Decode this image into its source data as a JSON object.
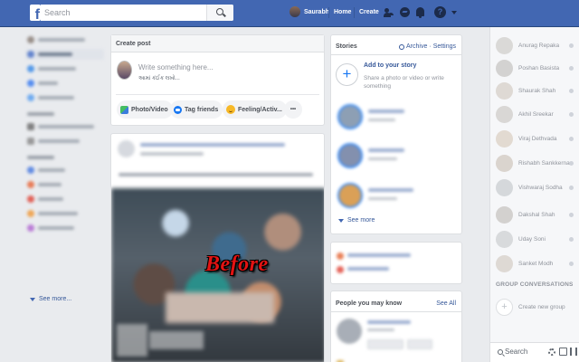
{
  "topbar": {
    "logo": "f",
    "search_placeholder": "Search",
    "user_name": "Saurabh",
    "home_label": "Home",
    "create_label": "Create",
    "help_glyph": "?"
  },
  "left_nav": {
    "see_more_label": "See more..."
  },
  "create_post": {
    "title": "Create post",
    "input_placeholder": "Write something here...",
    "sub_text": "આમાં કંઈક લખો...",
    "photo_video_label": "Photo/Video",
    "tag_friends_label": "Tag friends",
    "feeling_label": "Feeling/Activ...",
    "more_label": "•••"
  },
  "post": {
    "overlay_text": "Before"
  },
  "stories": {
    "title": "Stories",
    "archive_label": "Archive",
    "settings_label": "Settings",
    "separator": "·",
    "add_title": "Add to your story",
    "add_sub": "Share a photo or video or write something",
    "add_glyph": "+",
    "see_more_label": "See more"
  },
  "people": {
    "title": "People you may know",
    "see_all_label": "See All"
  },
  "chat": {
    "contacts": [
      {
        "name": "Anurag Repaka",
        "badge": "",
        "color": "#b9b3ad"
      },
      {
        "name": "Poshan Basista",
        "badge": "",
        "color": "#a8a59f"
      },
      {
        "name": "Shaurak Shah",
        "badge": "",
        "color": "#c2b4a6"
      },
      {
        "name": "Akhil Sreekar",
        "badge": "",
        "color": "#b5b0a9"
      },
      {
        "name": "Viraj Dethvada",
        "badge": "",
        "color": "#c9b6a0"
      },
      {
        "name": "Rishabh Sankkerna",
        "badge": "",
        "color": "#b8a89a"
      },
      {
        "name": "Vishwaraj Sodha",
        "badge": "",
        "color": "#aeb2b5"
      },
      {
        "name": "Dakshal Shah",
        "badge": "",
        "color": "#a9a29b"
      },
      {
        "name": "Uday Soni",
        "badge": "",
        "color": "#b4b6b8"
      },
      {
        "name": "Sanket Modh",
        "badge": "",
        "color": "#c0b3a7"
      }
    ],
    "group_title": "GROUP CONVERSATIONS",
    "new_group_label": "Create new group",
    "new_group_glyph": "+",
    "search_label": "Search"
  }
}
